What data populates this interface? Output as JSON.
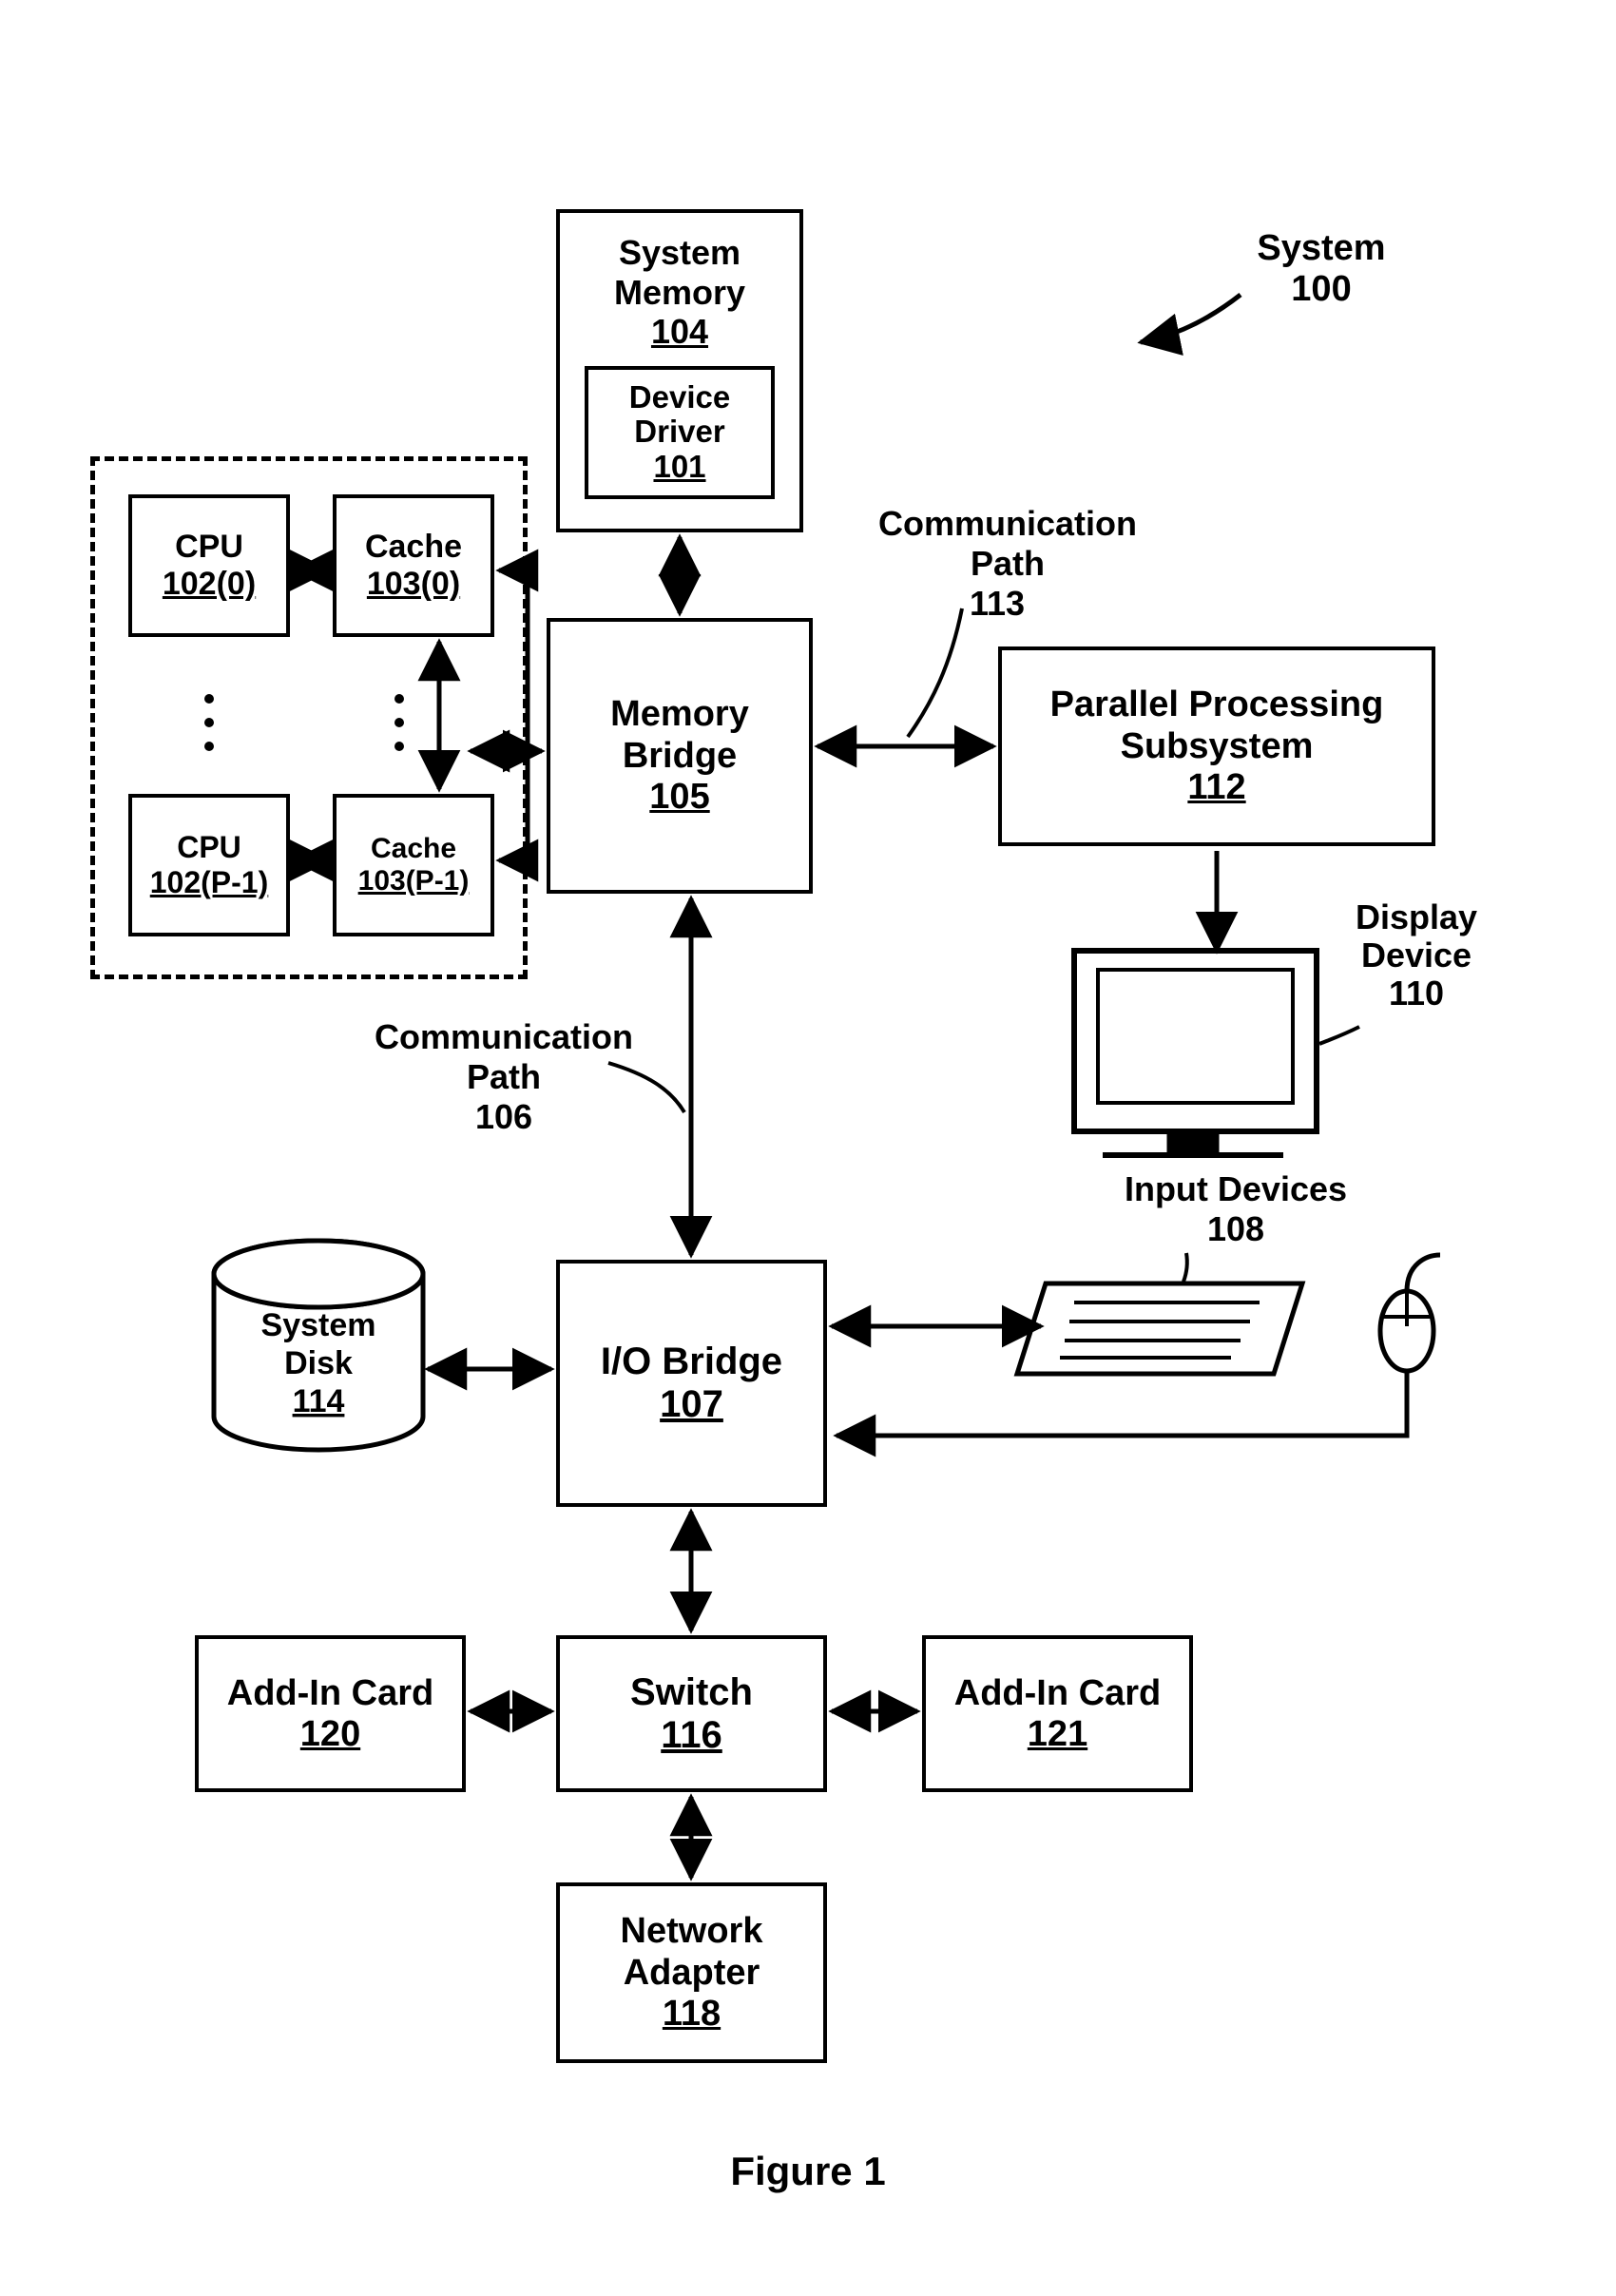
{
  "figure_caption": "Figure 1",
  "system_label": "System",
  "system_num": "100",
  "blocks": {
    "system_memory": {
      "title": "System Memory",
      "num": "104"
    },
    "device_driver": {
      "title": "Device Driver",
      "num": "101"
    },
    "memory_bridge": {
      "title": "Memory Bridge",
      "num": "105"
    },
    "pps": {
      "title": "Parallel Processing Subsystem",
      "num": "112"
    },
    "io_bridge": {
      "title": "I/O Bridge",
      "num": "107"
    },
    "switch": {
      "title": "Switch",
      "num": "116"
    },
    "net_adapter": {
      "title": "Network Adapter",
      "num": "118"
    },
    "addin_left": {
      "title": "Add-In Card",
      "num": "120"
    },
    "addin_right": {
      "title": "Add-In Card",
      "num": "121"
    },
    "system_disk": {
      "title": "System Disk",
      "num": "114"
    },
    "cpu0": {
      "title": "CPU",
      "num": "102(0)"
    },
    "cache0": {
      "title": "Cache",
      "num": "103(0)"
    },
    "cpuN": {
      "title": "CPU",
      "num": "102(P-1)"
    },
    "cacheN": {
      "title": "Cache",
      "num": "103(P-1)"
    }
  },
  "labels": {
    "comm_path_113": {
      "title": "Communication Path",
      "num": "113"
    },
    "comm_path_106": {
      "title": "Communication Path",
      "num": "106"
    },
    "display": {
      "title": "Display Device",
      "num": "110"
    },
    "input_devices": {
      "title": "Input Devices",
      "num": "108"
    }
  }
}
